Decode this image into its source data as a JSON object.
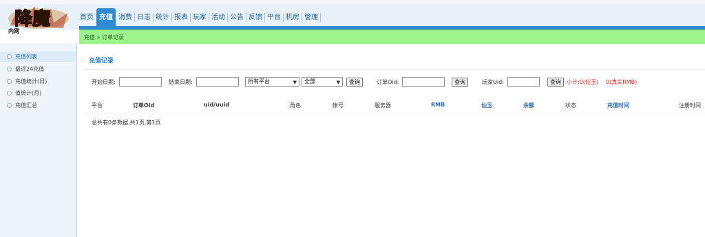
{
  "logo": {
    "brand": "降魔",
    "tag": "内网"
  },
  "nav": {
    "items": [
      "首页",
      "充值",
      "消费",
      "日志",
      "统计",
      "报表",
      "玩家",
      "活动",
      "公告",
      "反馈",
      "平台",
      "机房",
      "管理"
    ],
    "active": "充值"
  },
  "breadcrumb": {
    "text": "充值 » 订单记录"
  },
  "sidebar": {
    "items": [
      "充值列表",
      "最近24充值",
      "充值统计(日)",
      "值统计(月)",
      "充值汇总"
    ],
    "active_index": 0
  },
  "page": {
    "title": "充值记录"
  },
  "filters": {
    "start_date_label": "开始日期:",
    "start_date_value": "",
    "end_date_label": "结束日期:",
    "end_date_value": "",
    "platform_select": "所有平台",
    "server_select": "全部",
    "query_button": "查询",
    "order_oid_label": "订单Oid:",
    "order_oid_value": "",
    "query_button_2": "查询",
    "player_uid_label": "玩家Uid:",
    "player_uid_value": "",
    "query_button_3": "查询",
    "subtotal_text": "小计:0(仙玉)",
    "real_rmb_text": "0(真实RMB)"
  },
  "table": {
    "columns": [
      "平台",
      "订单Oid",
      "uid/uuid",
      "角色",
      "帐号",
      "服务器",
      "RMB",
      "仙玉",
      "余额",
      "状态",
      "充值时间",
      "注册时间"
    ],
    "rows": []
  },
  "pager": {
    "text": "总共有0条数据,共1页,第1页"
  },
  "colors": {
    "accent": "#2f8ad2",
    "breadcrumb_bg": "#9bf58a",
    "alert": "#e02020"
  }
}
